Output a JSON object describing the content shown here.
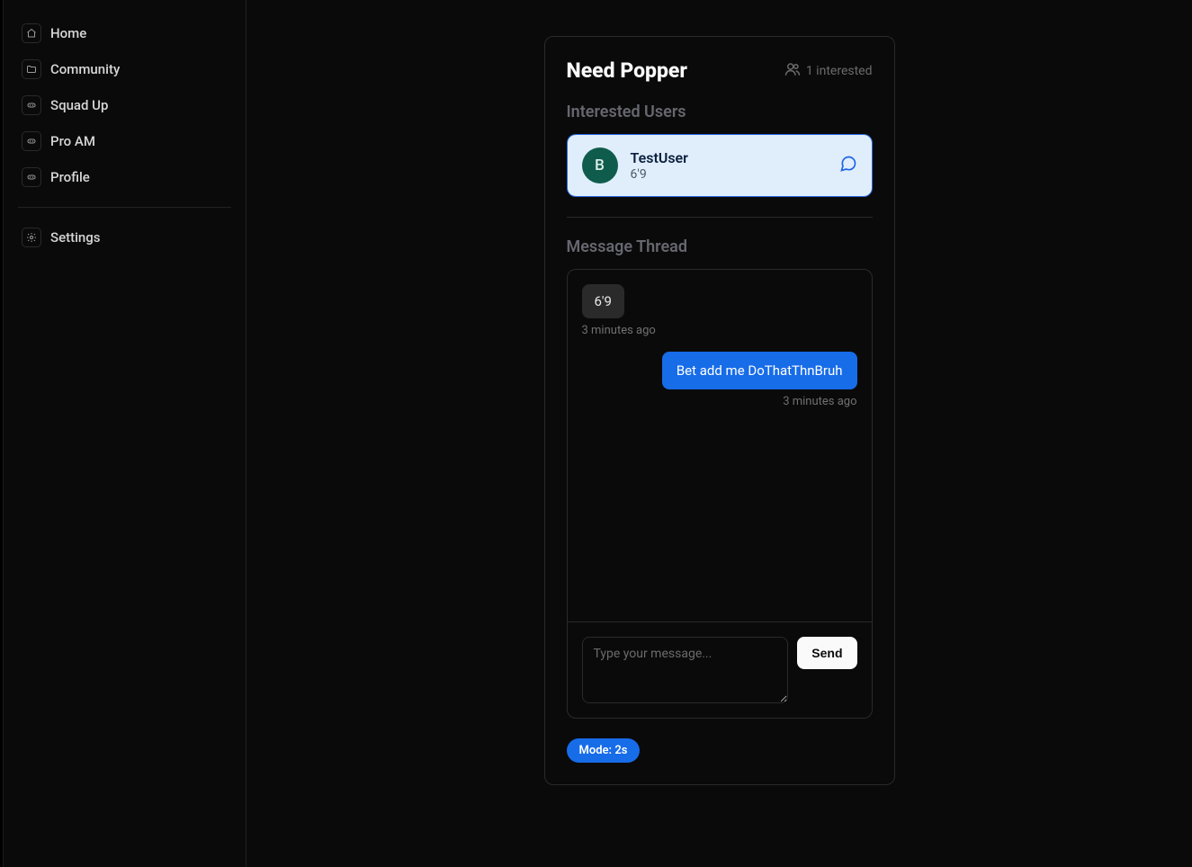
{
  "sidebar": {
    "items": [
      {
        "label": "Home"
      },
      {
        "label": "Community"
      },
      {
        "label": "Squad Up"
      },
      {
        "label": "Pro AM"
      },
      {
        "label": "Profile"
      }
    ],
    "settings_label": "Settings"
  },
  "post": {
    "title": "Need Popper",
    "interested_text": "1 interested",
    "section_users_title": "Interested Users",
    "section_thread_title": "Message Thread",
    "user": {
      "avatar_letter": "B",
      "name": "TestUser",
      "sub": "6'9"
    },
    "messages": [
      {
        "side": "left",
        "text": "6'9",
        "time": "3 minutes ago"
      },
      {
        "side": "right",
        "text": "Bet add me DoThatThnBruh",
        "time": "3 minutes ago"
      }
    ],
    "composer": {
      "placeholder": "Type your message...",
      "send_label": "Send"
    },
    "mode_badge": "Mode: 2s"
  }
}
